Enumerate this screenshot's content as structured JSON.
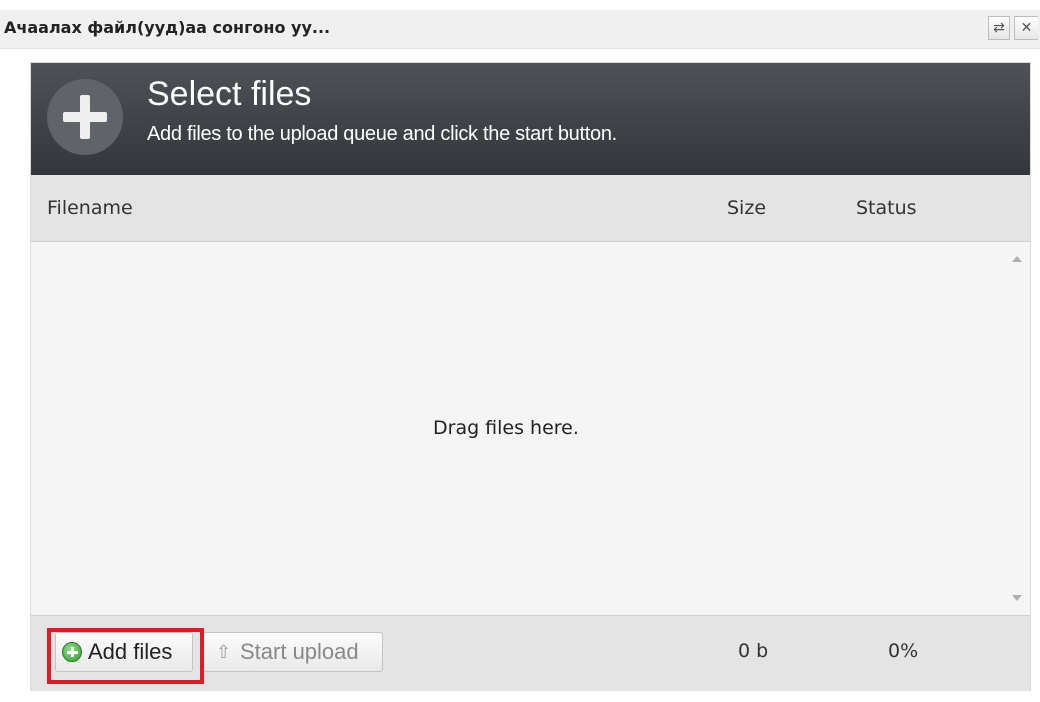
{
  "window": {
    "title": "Ачаалах файл(ууд)аа сонгоно уу...",
    "restore_glyph": "⇄",
    "close_glyph": "✕"
  },
  "uploader": {
    "header": {
      "title": "Select files",
      "subtitle": "Add files to the upload queue and click the start button.",
      "icon": "plus-icon"
    },
    "columns": {
      "filename": "Filename",
      "size": "Size",
      "status": "Status"
    },
    "filelist": {
      "empty_text": "Drag files here.",
      "files": []
    },
    "footer": {
      "add_files_label": "Add files",
      "add_files_icon": "add-circle-icon",
      "start_upload_label": "Start upload",
      "start_upload_icon": "arrow-up-icon",
      "start_upload_glyph": "⇧",
      "total_size": "0 b",
      "total_percent": "0%"
    },
    "highlight_color": "#e21b24"
  }
}
